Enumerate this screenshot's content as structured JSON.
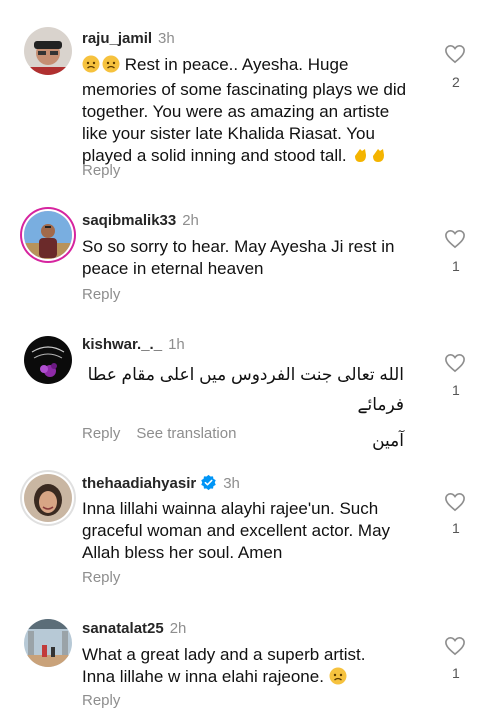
{
  "comments": [
    {
      "username": "raju_jamil",
      "time": "3h",
      "text": "Rest in peace.. Ayesha. Huge memories of some fascinating plays we did together. You were as amazing an artiste like your sister late Khalida Riasat. You played a solid inning and stood tall.",
      "reply": "Reply",
      "likes": "2"
    },
    {
      "username": "saqibmalik33",
      "time": "2h",
      "text": "So so sorry to hear. May Ayesha Ji rest in peace in eternal heaven",
      "reply": "Reply",
      "likes": "1"
    },
    {
      "username": "kishwar._._",
      "time": "1h",
      "text_line1": "الله تعالی جنت الفردوس میں اعلی مقام عطا فرمائے",
      "text_line2": "آمین",
      "reply": "Reply",
      "see_translation": "See translation",
      "likes": "1"
    },
    {
      "username": "thehaadiahyasir",
      "time": "3h",
      "text": "Inna lillahi wainna alayhi rajee'un. Such graceful woman and excellent actor. May Allah bless her soul. Amen",
      "reply": "Reply",
      "likes": "1"
    },
    {
      "username": "sanatalat25",
      "time": "2h",
      "text": "What a great lady and a superb artist. Inna lillahe w inna elahi rajeone.",
      "reply": "Reply",
      "likes": "1"
    }
  ],
  "colors": {
    "accent_ring": "#d6249f",
    "verified": "#0095f6",
    "muted": "#8e8e8e"
  }
}
